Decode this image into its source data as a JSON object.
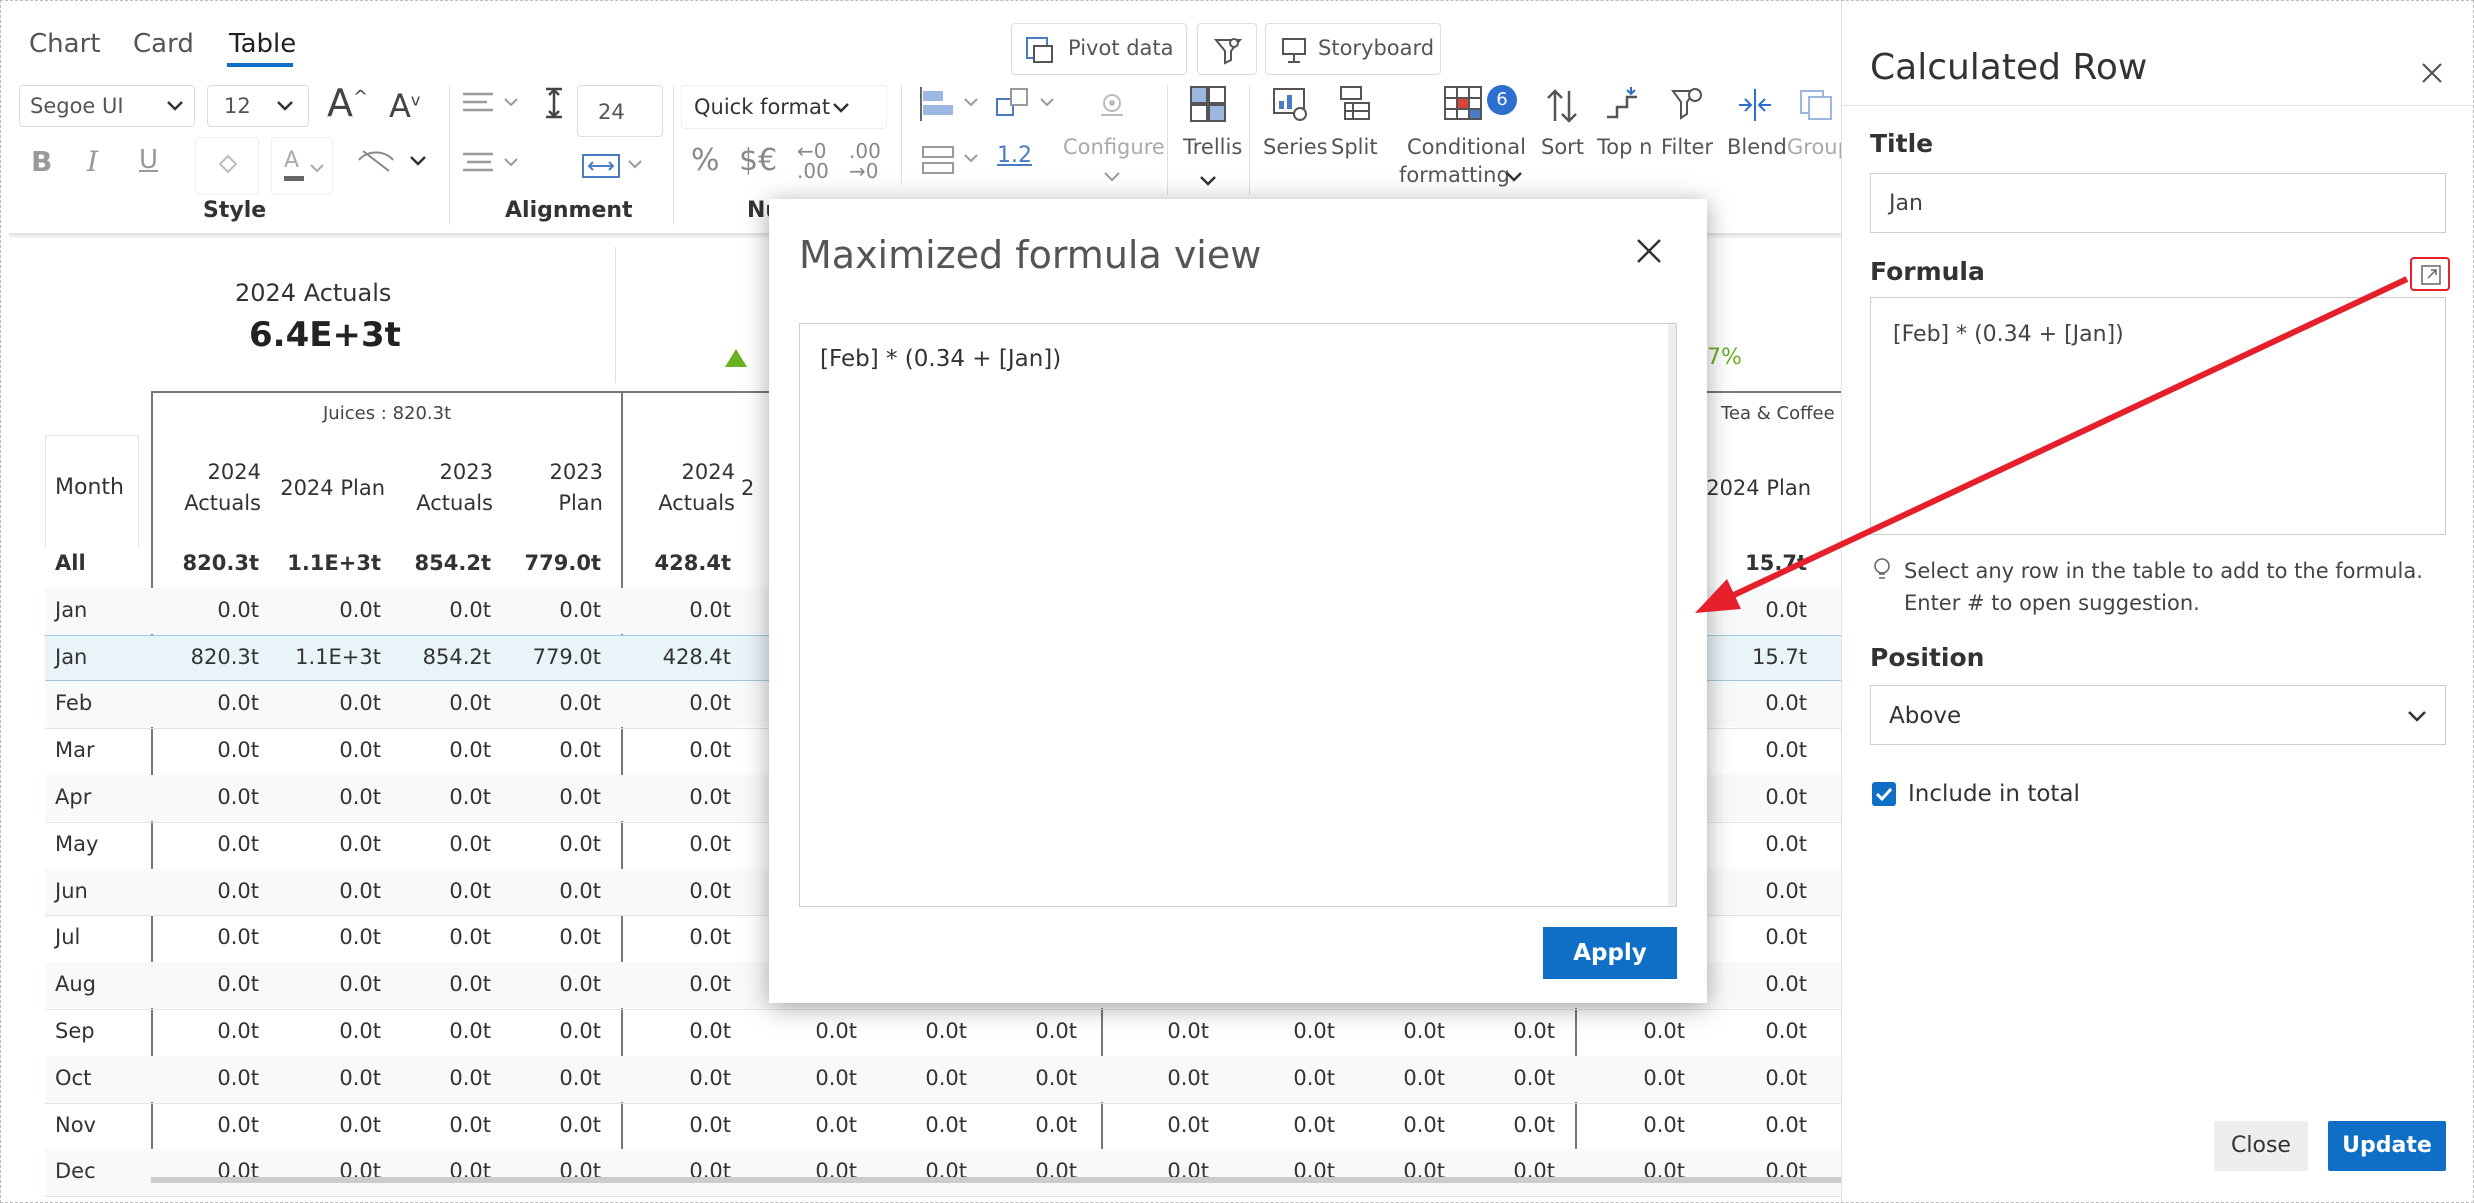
{
  "tabs": [
    "Chart",
    "Card",
    "Table"
  ],
  "active_tab": "Table",
  "toolbar": {
    "font": "Segoe UI",
    "font_size": "12",
    "line_height": "24",
    "quick_format": "Quick format",
    "pivot_data": "Pivot  data",
    "storyboard": "Storyboard",
    "number_format": "1.2",
    "configure": "Configure",
    "trellis": "Trellis",
    "series": "Series",
    "split": "Split",
    "conditional": "Conditional",
    "formatting": "formatting",
    "badge": "6",
    "sort": "Sort",
    "topn": "Top n",
    "filter": "Filter",
    "blend": "Blend",
    "group": "Group",
    "groups": {
      "style": "Style",
      "alignment": "Alignment",
      "number": "Nu"
    }
  },
  "kpi": {
    "title": "2024 Actuals",
    "value": "6.4E+3t",
    "pct": "7%"
  },
  "groups": {
    "juices": "Juices :  820.3t",
    "tea": "Tea & Coffee :"
  },
  "table": {
    "month_header": "Month",
    "cols1": [
      [
        "2024",
        "Actuals"
      ],
      [
        "2024 Plan"
      ],
      [
        "2023",
        "Actuals"
      ],
      [
        "2023",
        "Plan"
      ]
    ],
    "col2": [
      "2024",
      "Actuals"
    ],
    "col2_partial": "2",
    "tea_col": "2024 Plan",
    "months": [
      "All",
      "Jan",
      "Jan",
      "Feb",
      "Mar",
      "Apr",
      "May",
      "Jun",
      "Jul",
      "Aug",
      "Sep",
      "Oct",
      "Nov",
      "Dec"
    ],
    "g1_all": [
      "820.3t",
      "1.1E+3t",
      "854.2t",
      "779.0t"
    ],
    "g1_jan2": [
      "820.3t",
      "1.1E+3t",
      "854.2t",
      "779.0t"
    ],
    "zero": "0.0t",
    "g2_all": "428.4t",
    "g2_jan2": "428.4t",
    "tea_all": "15.7t",
    "tea_jan2": "15.7t"
  },
  "dialog": {
    "title": "Maximized formula view",
    "formula": "[Feb] * (0.34 + [Jan])",
    "apply": "Apply"
  },
  "panel": {
    "title": "Calculated Row",
    "title_label": "Title",
    "title_value": "Jan",
    "formula_label": "Formula",
    "formula_value": "[Feb] * (0.34 + [Jan])",
    "hint1": "Select any row in the table to add to the formula.",
    "hint2": "Enter # to open suggestion.",
    "position_label": "Position",
    "position_value": "Above",
    "include_label": "Include in total",
    "close": "Close",
    "update": "Update"
  },
  "colors": {
    "accent": "#0f6fc6",
    "arrow": "#e5202b",
    "kpi_up": "#6ab023",
    "highlight": "#e8f4f8"
  }
}
